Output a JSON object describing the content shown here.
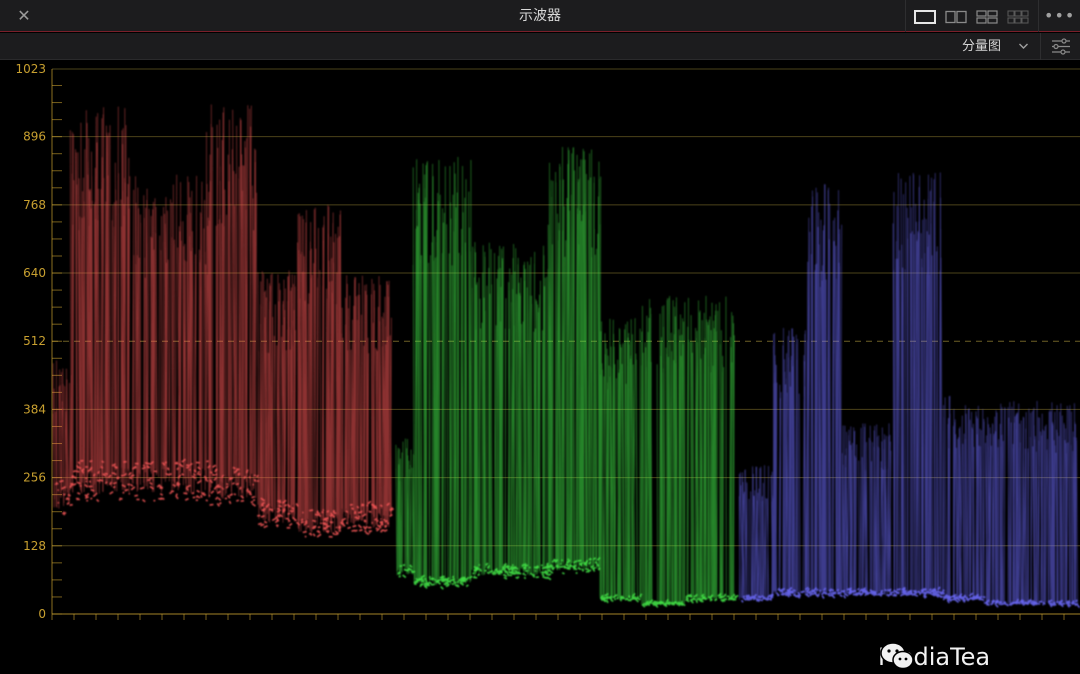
{
  "window": {
    "title": "示波器",
    "close_icon": "close-icon",
    "more_icon": "more-horizontal-icon"
  },
  "layout_buttons": [
    {
      "name": "single-view",
      "active": true
    },
    {
      "name": "dual-view",
      "active": false
    },
    {
      "name": "quad-view",
      "active": false
    },
    {
      "name": "multi-view",
      "active": false
    }
  ],
  "toolbar": {
    "mode_label": "分量图",
    "mode_icon": "chevron-down-icon",
    "settings_icon": "sliders-icon"
  },
  "scope": {
    "y_ticks": [
      "1023",
      "896",
      "768",
      "640",
      "512",
      "384",
      "256",
      "128",
      "0"
    ],
    "y_range": [
      0,
      1023
    ],
    "channels": [
      {
        "name": "R",
        "color": "#ff5a5a"
      },
      {
        "name": "G",
        "color": "#46f04a"
      },
      {
        "name": "B",
        "color": "#6e6cff"
      }
    ],
    "grid_color": "#8a7a30",
    "tick_color": "#c8a030"
  },
  "watermark": {
    "text": "MediaTea",
    "icon": "wechat-icon"
  }
}
